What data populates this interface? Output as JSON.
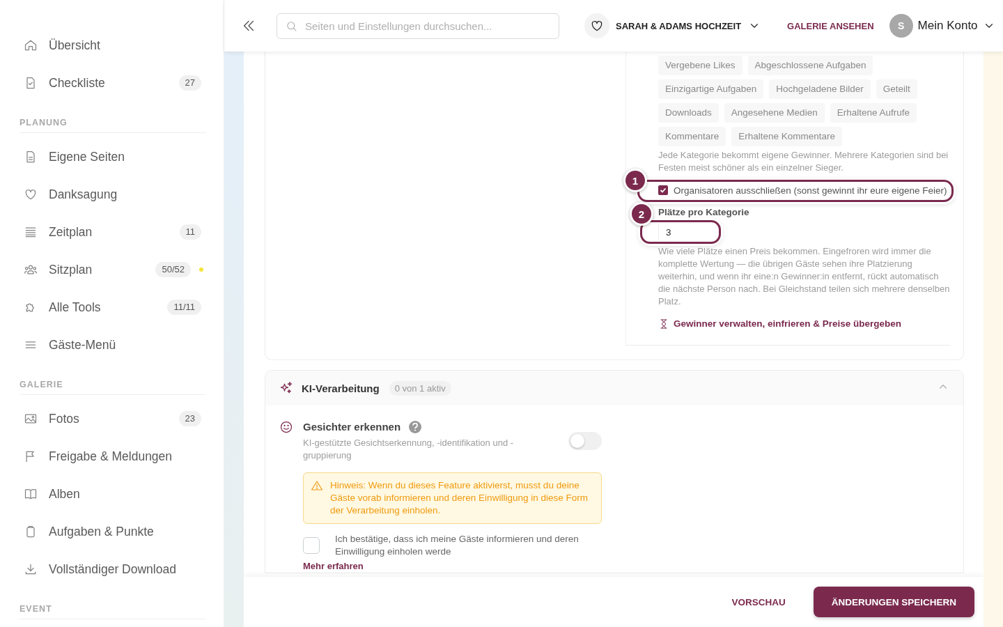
{
  "sidebar": {
    "groups": [
      {
        "items": [
          {
            "label": "Übersicht",
            "flagged": false
          },
          {
            "label": "Checkliste",
            "badge": "27",
            "flagged": false
          }
        ]
      },
      {
        "heading": "PLANUNG",
        "items": [
          {
            "label": "Eigene Seiten",
            "flagged": false
          },
          {
            "label": "Danksagung",
            "flagged": false
          },
          {
            "label": "Zeitplan",
            "badge": "11",
            "flagged": false
          },
          {
            "label": "Sitzplan",
            "badge": "50/52",
            "flagged": true
          },
          {
            "label": "Alle Tools",
            "badge": "11/11",
            "flagged": false
          },
          {
            "label": "Gäste-Menü",
            "flagged": false
          }
        ]
      },
      {
        "heading": "GALERIE",
        "items": [
          {
            "label": "Fotos",
            "badge": "23",
            "flagged": false
          },
          {
            "label": "Freigabe & Meldungen",
            "flagged": false
          },
          {
            "label": "Alben",
            "flagged": false
          },
          {
            "label": "Aufgaben & Punkte",
            "flagged": false
          },
          {
            "label": "Vollständiger Download",
            "flagged": false
          }
        ]
      },
      {
        "heading": "EVENT"
      }
    ]
  },
  "header": {
    "search": {
      "placeholder": "Seiten und Einstellungen durchsuchen..."
    },
    "event": {
      "name": "SARAH & ADAMS HOCHZEIT"
    },
    "gallery_link": "GALERIE ANSEHEN",
    "account": {
      "initial": "S",
      "label": "Mein Konto"
    }
  },
  "ranking": {
    "categories": [
      {
        "label": "Vergebene Likes"
      },
      {
        "label": "Abgeschlossene Aufgaben"
      },
      {
        "label": "Einzigartige Aufgaben"
      },
      {
        "label": "Hochgeladene Bilder"
      },
      {
        "label": "Geteilt"
      },
      {
        "label": "Downloads"
      },
      {
        "label": "Angesehene Medien"
      },
      {
        "label": "Erhaltene Aufrufe"
      },
      {
        "label": "Kommentare"
      },
      {
        "label": "Erhaltene Kommentare"
      }
    ],
    "hint": "Jede Kategorie bekommt eigene Gewinner. Mehrere Kategorien sind bei Festen meist schöner als ein einzelner Sieger.",
    "exclude_organizers": {
      "label": "Organisatoren ausschließen (sonst gewinnt ihr eure eigene Feier)",
      "checked": true,
      "annotation": "1"
    },
    "places": {
      "label": "Plätze pro Kategorie",
      "value": "3",
      "annotation": "2",
      "hint": "Wie viele Plätze einen Preis bekommen. Eingefroren wird immer die komplette Wertung — die übrigen Gäste sehen ihre Platzierung weiterhin, und wenn ihr eine:n Gewinner:in entfernt, rückt automatisch die nächste Person nach. Bei Gleichstand teilen sich mehrere denselben Platz."
    },
    "winners_link": "Gewinner verwalten, einfrieren & Preise übergeben"
  },
  "ai_processing": {
    "title": "KI-Verarbeitung",
    "status": "0 von 1 aktiv",
    "expanded": true,
    "features": [
      {
        "title": "Gesichter erkennen",
        "description": "KI-gestützte Gesichtserkennung, -identifikation und -gruppierung",
        "on": false,
        "notice": "Hinweis: Wenn du dieses Feature aktivierst, musst du deine Gäste vorab informieren und deren Einwilligung in diese Form der Verarbeitung einholen.",
        "consent": {
          "label": "Ich bestätige, dass ich meine Gäste informieren und deren Einwilligung einholen werde",
          "checked": false
        },
        "more_link": "Mehr erfahren"
      }
    ]
  },
  "footer": {
    "preview": "VORSCHAU",
    "save": "ÄNDERUNGEN SPEICHERN"
  }
}
